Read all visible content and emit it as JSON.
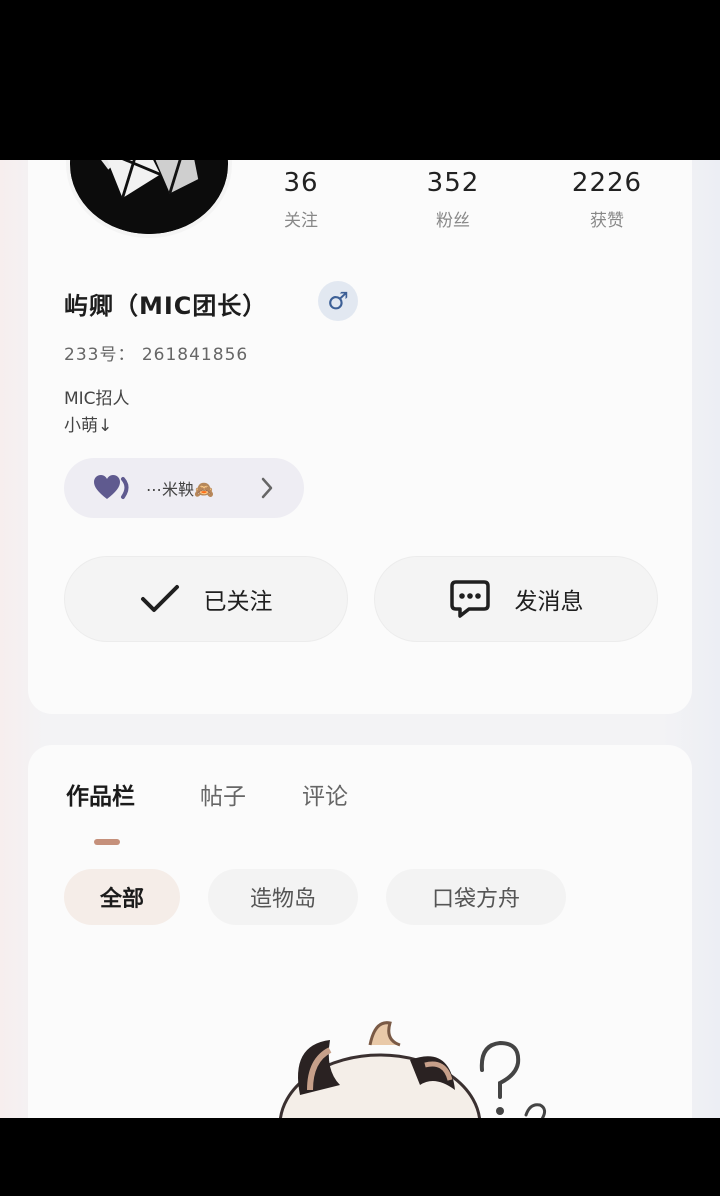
{
  "profile": {
    "stats": [
      {
        "value": "36",
        "label": "关注"
      },
      {
        "value": "352",
        "label": "粉丝"
      },
      {
        "value": "2226",
        "label": "获赞"
      }
    ],
    "username": "屿卿（MIC团长）",
    "gender_symbol": "♂",
    "uid": "233号： 261841856",
    "bio_lines": [
      "MIC招人",
      "小萌↓"
    ],
    "badge_text": "⋯米鞅🙈",
    "follow_label": "已关注",
    "message_label": "发消息"
  },
  "works": {
    "tabs": [
      "作品栏",
      "帖子",
      "评论"
    ],
    "filters": [
      "全部",
      "造物岛",
      "口袋方舟"
    ]
  },
  "colors": {
    "accent": "#c5907b",
    "gender_badge": "#e2e8f1",
    "badge_heart": "#5f5a8f"
  },
  "icons": {
    "gender": "male-icon",
    "badge": "heart-badge-icon",
    "follow": "check-icon",
    "message": "chat-bubble-icon",
    "badge_arrow": "chevron-right-icon"
  }
}
